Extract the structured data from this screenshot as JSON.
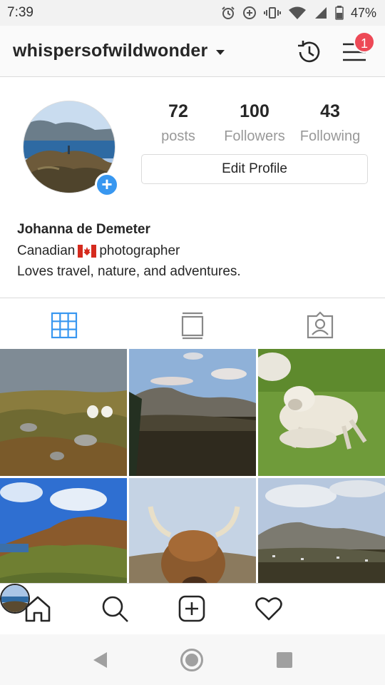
{
  "status_bar": {
    "time": "7:39",
    "battery_percent": "47%",
    "icons": [
      "alarm-icon",
      "data-saver-icon",
      "vibrate-icon",
      "wifi-icon",
      "cell-signal-icon",
      "battery-icon"
    ]
  },
  "header": {
    "username": "whispersofwildwonder",
    "notification_count": "1",
    "icons": [
      "chevron-down-icon",
      "history-icon",
      "menu-icon"
    ]
  },
  "profile": {
    "stats": [
      {
        "value": "72",
        "label": "posts"
      },
      {
        "value": "100",
        "label": "Followers"
      },
      {
        "value": "43",
        "label": "Following"
      }
    ],
    "edit_button_label": "Edit Profile",
    "name": "Johanna de Demeter",
    "bio_line1_before": "Canadian",
    "bio_line1_after": "photographer",
    "bio_line2": "Loves travel, nature, and adventures."
  },
  "tabs": [
    "grid-icon",
    "feed-icon",
    "tagged-icon"
  ],
  "colors": {
    "accent": "#3897f0",
    "badge": "#ed4956",
    "text": "#262626",
    "muted": "#999999",
    "border": "#dbdbdb"
  },
  "bottom_nav": [
    "home-icon",
    "search-icon",
    "add-post-icon",
    "heart-icon",
    "profile-avatar"
  ],
  "android_nav": [
    "back-icon",
    "home-circle-icon",
    "recents-icon"
  ]
}
